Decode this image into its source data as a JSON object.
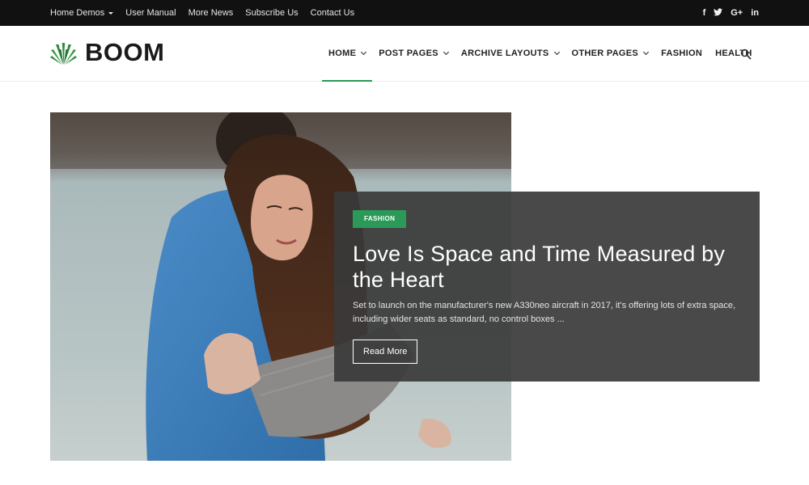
{
  "topbar": {
    "links": [
      "Home Demos",
      "User Manual",
      "More News",
      "Subscribe Us",
      "Contact Us"
    ],
    "social": [
      "f",
      "t",
      "G+",
      "in"
    ]
  },
  "header": {
    "logo_text": "BOOM",
    "nav": [
      {
        "label": "HOME",
        "dropdown": true,
        "active": true
      },
      {
        "label": "POST PAGES",
        "dropdown": true
      },
      {
        "label": "ARCHIVE LAYOUTS",
        "dropdown": true
      },
      {
        "label": "OTHER PAGES",
        "dropdown": true
      },
      {
        "label": "FASHION",
        "dropdown": false
      },
      {
        "label": "HEALTH",
        "dropdown": false
      }
    ],
    "search_icon": "search-icon"
  },
  "hero": {
    "category": "FASHION",
    "title": "Love Is Space and Time Measured by the Heart",
    "excerpt": "Set to launch on the manufacturer's new A330neo aircraft in 2017, it's offering lots of extra space, including wider seats as standard, no control boxes ...",
    "button": "Read More"
  },
  "colors": {
    "accent": "#2b9a58",
    "topbar": "#111111",
    "overlay": "#3a3a3a"
  }
}
